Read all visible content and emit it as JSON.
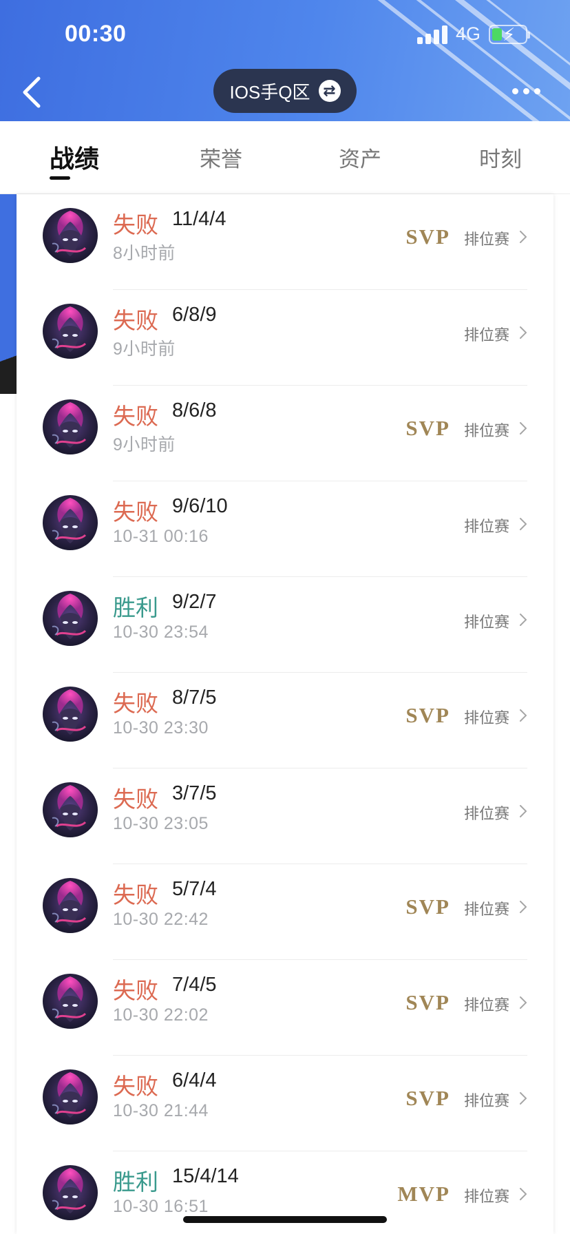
{
  "status_bar": {
    "time": "00:30",
    "network": "4G"
  },
  "header": {
    "server_label": "IOS手Q区"
  },
  "tabs": [
    {
      "label": "战绩",
      "active": true
    },
    {
      "label": "荣誉",
      "active": false
    },
    {
      "label": "资产",
      "active": false
    },
    {
      "label": "时刻",
      "active": false
    }
  ],
  "colors": {
    "loss": "#dc6a52",
    "win": "#3a9a8d",
    "badge": "#a08656",
    "header": "#3e6ee0"
  },
  "matches": [
    {
      "result": "失败",
      "kda": "11/4/4",
      "time": "8小时前",
      "badge": "SVP",
      "mode": "排位赛"
    },
    {
      "result": "失败",
      "kda": "6/8/9",
      "time": "9小时前",
      "badge": "",
      "mode": "排位赛"
    },
    {
      "result": "失败",
      "kda": "8/6/8",
      "time": "9小时前",
      "badge": "SVP",
      "mode": "排位赛"
    },
    {
      "result": "失败",
      "kda": "9/6/10",
      "time": "10-31 00:16",
      "badge": "",
      "mode": "排位赛"
    },
    {
      "result": "胜利",
      "kda": "9/2/7",
      "time": "10-30 23:54",
      "badge": "",
      "mode": "排位赛"
    },
    {
      "result": "失败",
      "kda": "8/7/5",
      "time": "10-30 23:30",
      "badge": "SVP",
      "mode": "排位赛"
    },
    {
      "result": "失败",
      "kda": "3/7/5",
      "time": "10-30 23:05",
      "badge": "",
      "mode": "排位赛"
    },
    {
      "result": "失败",
      "kda": "5/7/4",
      "time": "10-30 22:42",
      "badge": "SVP",
      "mode": "排位赛"
    },
    {
      "result": "失败",
      "kda": "7/4/5",
      "time": "10-30 22:02",
      "badge": "SVP",
      "mode": "排位赛"
    },
    {
      "result": "失败",
      "kda": "6/4/4",
      "time": "10-30 21:44",
      "badge": "SVP",
      "mode": "排位赛"
    },
    {
      "result": "胜利",
      "kda": "15/4/14",
      "time": "10-30 16:51",
      "badge": "MVP",
      "mode": "排位赛"
    }
  ]
}
